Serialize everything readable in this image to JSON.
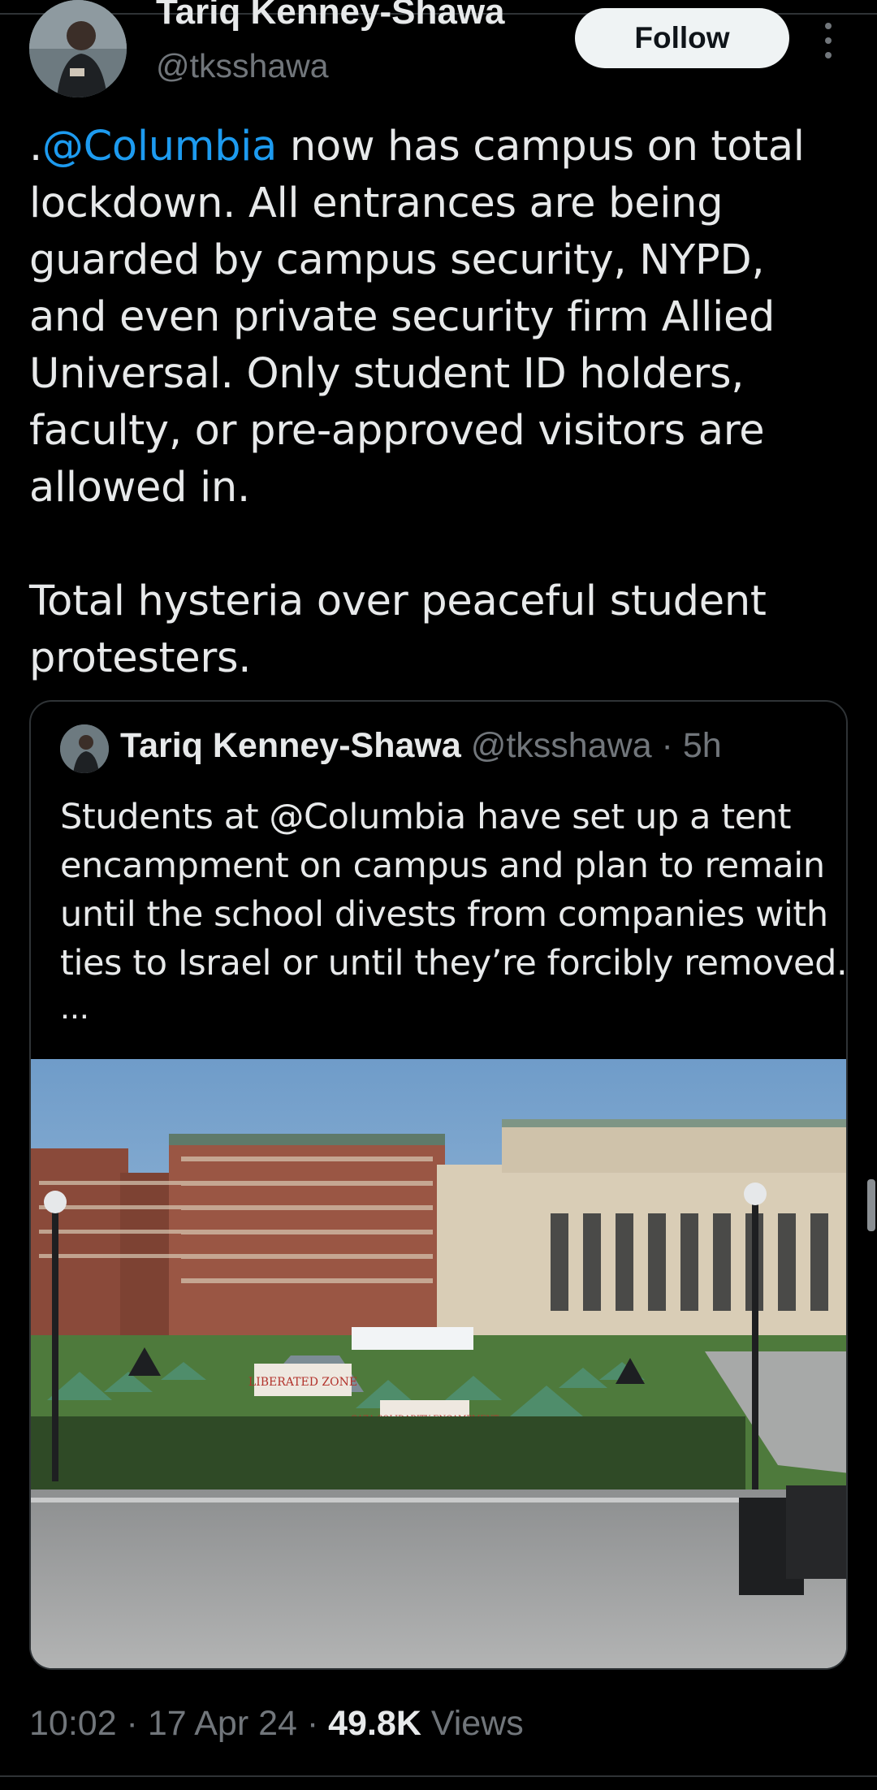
{
  "author": {
    "name": "Tariq Kenney-Shawa",
    "handle": "@tksshawa"
  },
  "actions": {
    "follow_label": "Follow",
    "more_icon": "more-vertical-icon"
  },
  "tweet": {
    "lines": [
      ".",
      "@Columbia",
      " now has campus on total",
      "lockdown. All entrances are being",
      "guarded by campus security, NYPD,",
      "and even private security firm Allied",
      "Universal. Only student ID holders,",
      "faculty, or pre-approved visitors are",
      "allowed in.",
      "Total hysteria over peaceful student",
      "protesters."
    ]
  },
  "quoted": {
    "name": "Tariq Kenney-Shawa",
    "meta": " @tksshawa · 5h",
    "lines": [
      "Students at @Columbia have set up a tent",
      "encampment on campus and plan to remain",
      "until the school divests from companies with",
      "ties to Israel or until they’re forcibly removed."
    ],
    "ellipsis": "...",
    "photo_signs": [
      "LIBERATED ZONE",
      "GAZA SOLIDARITY ENCAMPMENT"
    ]
  },
  "footer": {
    "time_date": "10:02 · 17 Apr 24 · ",
    "views_count": "49.8K",
    "views_label": " Views"
  },
  "colors": {
    "background": "#000000",
    "text": "#e7e9ea",
    "muted": "#71767b",
    "link": "#1d9bf0",
    "border": "#2f3336"
  }
}
